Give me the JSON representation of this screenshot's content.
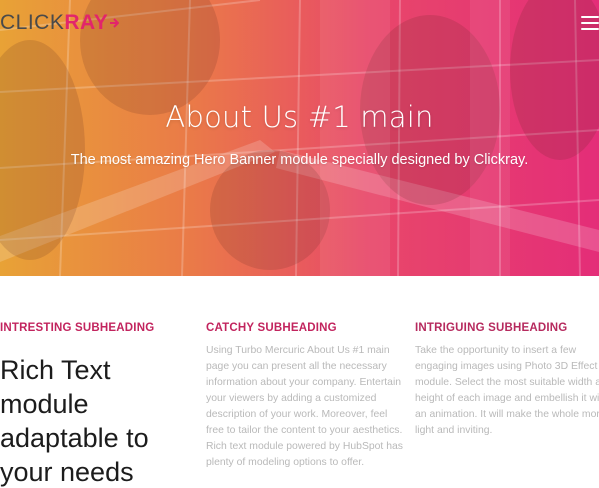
{
  "header": {
    "logo": {
      "text": "CLICK",
      "mark": "RAY"
    },
    "menu_icon": "hamburger-menu-icon"
  },
  "hero": {
    "title": "About Us #1 main",
    "subtitle": "The most amazing Hero Banner module specially designed by Clickray."
  },
  "columns": [
    {
      "subheading": "INTRESTING SUBHEADING",
      "heading_lines": [
        "Rich Text",
        "module",
        "adaptable to",
        "your needs"
      ]
    },
    {
      "subheading": "CATCHY SUBHEADING",
      "lines": [
        "Using Turbo Mercuric About Us #1 main",
        "page you can present all the necessary",
        "information about your company. Entertain",
        "your viewers by adding a customized",
        "description of your work. Moreover, feel",
        "free to tailor the content to your aesthetics.",
        "Rich text module powered by HubSpot has",
        "plenty of modeling options to offer."
      ]
    },
    {
      "subheading": "INTRIGUING SUBHEADING",
      "lines": [
        "Take the opportunity to insert a few",
        "engaging images using Photo 3D Effect",
        "module. Select the most suitable width and",
        "height of each image and embellish it with",
        "an animation. It will make the whole more",
        "light and inviting."
      ]
    }
  ],
  "colors": {
    "brand": "#e2256b",
    "hero_gradient_start": "#e8a236",
    "hero_gradient_end": "#e42d78",
    "subheading": "#c2245e",
    "paragraph": "#b9b9b9"
  }
}
